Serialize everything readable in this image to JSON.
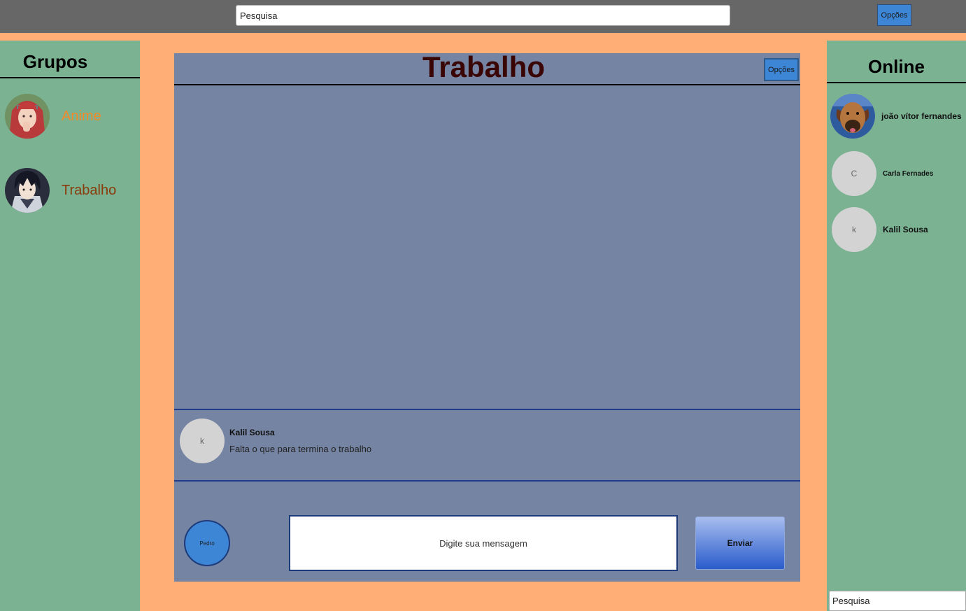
{
  "top": {
    "search_placeholder": "Pesquisa",
    "options_label": "Opções"
  },
  "groups": {
    "title": "Grupos",
    "items": [
      {
        "label": "Anime",
        "color": "#f48a2a"
      },
      {
        "label": "Trabalho",
        "color": "#8a3b0a"
      }
    ]
  },
  "chat": {
    "title": "Trabalho",
    "options_label": "Opções",
    "messages": [
      {
        "avatar_letter": "k",
        "author": "Kalil Sousa",
        "text": "Falta o que para termina o trabalho"
      }
    ],
    "me_label": "Pedro",
    "input_placeholder": "Digite sua mensagem",
    "send_label": "Enviar"
  },
  "online": {
    "title": "Online",
    "users": [
      {
        "avatar_letter": "",
        "name": "joão vítor fernandes"
      },
      {
        "avatar_letter": "C",
        "name": "Carla Fernades"
      },
      {
        "avatar_letter": "k",
        "name": "Kalil Sousa"
      }
    ],
    "search_placeholder": "Pesquisa"
  },
  "colors": {
    "background": "#ffae76",
    "sidebar": "#7ab292",
    "chat_panel": "#7584a2",
    "accent": "#3d86d6",
    "topbar": "#676767"
  }
}
